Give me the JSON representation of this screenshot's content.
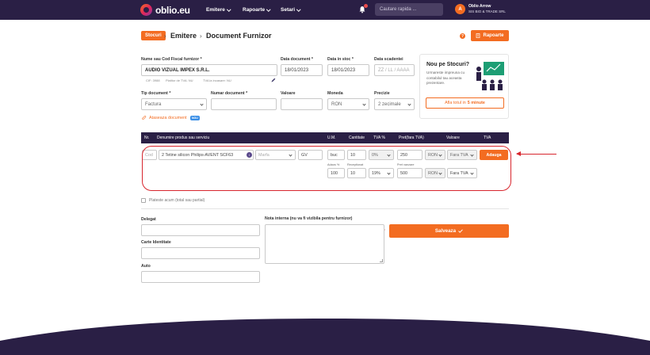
{
  "header": {
    "brand": "oblio.eu",
    "nav": [
      {
        "label": "Emitere"
      },
      {
        "label": "Rapoarte"
      },
      {
        "label": "Setari"
      }
    ],
    "search_placeholder": "Cautare rapida ...",
    "user_name": "Oblio Arrow",
    "user_company": "SIS BIO & TRADE SRL",
    "user_initial": "A"
  },
  "breadcrumb": {
    "section": "Stocuri",
    "items": [
      "Emitere",
      "Document Furnizor"
    ]
  },
  "toolbar": {
    "help": "?",
    "rapoarte_label": "Rapoarte"
  },
  "form": {
    "supplier_label": "Nume sau Cod Fiscal furnizor *",
    "supplier_value": "AUDIO VIZUAL IMPEX S.R.L.",
    "supplier_note_cif": "CIF: 3988",
    "supplier_note_vat": "Platitor de TVA: NU",
    "supplier_note_cash": "TVA la incasare: NU",
    "doc_date_label": "Data document *",
    "doc_date_value": "18/01/2023",
    "stock_date_label": "Data in stoc *",
    "stock_date_value": "18/01/2023",
    "due_date_label": "Data scadentei",
    "due_date_placeholder": "ZZ / LL / AAAA",
    "doc_type_label": "Tip document *",
    "doc_type_value": "Factura",
    "doc_number_label": "Numar document *",
    "value_label": "Valoare",
    "currency_label": "Moneda",
    "currency_value": "RON",
    "precision_label": "Precizie",
    "precision_value": "2 zecimale",
    "attach_label": "Ataseaza document",
    "attach_badge": "NOU"
  },
  "promo": {
    "title": "Nou pe Stocuri?",
    "text": "Urmareste impreuna cu contabilul tau aceasta prezentare.",
    "button_prefix": "Afla totul in",
    "button_bold": "5 minute"
  },
  "table": {
    "headers": [
      "Nr.",
      "Denumire produs sau serviciu",
      "U.M.",
      "Cantitate",
      "TVA %",
      "Pret(fara TVA)",
      "Valoare",
      "TVA"
    ],
    "row": {
      "code_placeholder": "Cod",
      "product": "2 Tetine silicon Philips-AVENT SCF63",
      "info": "i",
      "brand_placeholder": "Marfa",
      "gestiune": "GV",
      "um": "buc",
      "quantity": "10",
      "vat": "0%",
      "price": "250",
      "currency1": "RON",
      "vat_mode1": "Fara TVA",
      "adauga_label": "Adauga",
      "markup_label": "Adaos %",
      "markup_value": "100",
      "received_label": "Receptionat",
      "received_value": "10",
      "vat2": "19%",
      "sale_price_label": "Pret vanzare",
      "sale_price_value": "500",
      "currency2": "RON",
      "vat_mode2": "Fara TVA"
    }
  },
  "payment": {
    "label": "Plateste acum (total sau partial)"
  },
  "bottom": {
    "delegat_label": "Delegat",
    "id_card_label": "Carte Identitate",
    "auto_label": "Auto",
    "internal_note_label": "Nota interna (nu va fi vizibila pentru furnizor)",
    "save_label": "Salveaza"
  },
  "colors": {
    "brand_dark": "#2a1f45",
    "accent": "#f36c21",
    "highlight": "#d8262e"
  }
}
